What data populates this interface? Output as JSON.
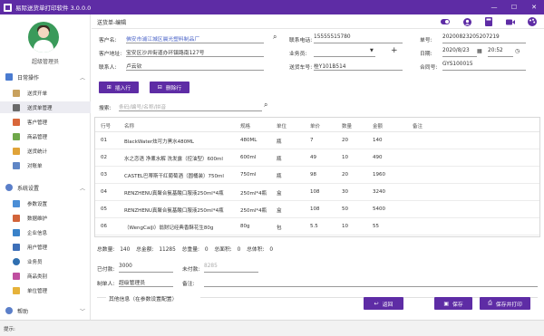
{
  "window": {
    "title": "易际送货单打印软件 3.0.0.0",
    "min": "—",
    "max": "☐",
    "close": "✕"
  },
  "user": {
    "name": "超级管理员"
  },
  "sidebar": {
    "groups": [
      {
        "label": "日常操作",
        "items": [
          "送货开单",
          "送货单管理",
          "客户管理",
          "商品管理",
          "送货统计",
          "对账单"
        ]
      },
      {
        "label": "系统设置",
        "items": [
          "参数设置",
          "数据维护",
          "企业信息",
          "用户管理",
          "业务员",
          "商品类别",
          "单位管理"
        ]
      },
      {
        "label": "帮助"
      }
    ]
  },
  "breadcrumb": "送货单-编辑",
  "form": {
    "customer_name_label": "客户名:",
    "customer_name": "佛安市浦江城区晨光塑料制品厂",
    "contact_phone_label": "联系电话:",
    "contact_phone": "15555515780",
    "order_no_label": "单号:",
    "order_no": "20200823205207219",
    "address_label": "客户地址:",
    "address": "宝安区沙井街道办环镇路南127号",
    "salesman_label": "业务员:",
    "salesman": "",
    "date_label": "日期:",
    "date": "2020/8/23",
    "time": "20:52",
    "contact_label": "联系人:",
    "contact": "卢云钦",
    "carrier_label": "送货车号:",
    "carrier": "桂Y101B514",
    "contract_label": "合同号:",
    "contract": "GYS100015"
  },
  "actions": {
    "insert": "插入行",
    "delete": "删除行"
  },
  "search": {
    "label": "搜索:",
    "placeholder": "条码/编号/名称/拼音"
  },
  "table": {
    "headers": [
      "行号",
      "名称",
      "规格",
      "单位",
      "单价",
      "数量",
      "金额",
      "备注"
    ],
    "rows": [
      [
        "01",
        "BlackWater炫可力黑水480ML",
        "480ML",
        "瓶",
        "7",
        "20",
        "140",
        ""
      ],
      [
        "02",
        "水之恋语 净薰水解 洗发露（控油型）600ml",
        "600ml",
        "瓶",
        "49",
        "10",
        "490",
        ""
      ],
      [
        "03",
        "CASTEL巴蒂斯干红葡萄酒（圆桶装）750ml",
        "750ml",
        "瓶",
        "98",
        "20",
        "1960",
        ""
      ],
      [
        "04",
        "RENZHENU真聚合氨基酸口服液250ml*4瓶",
        "250ml*4瓶",
        "盒",
        "108",
        "30",
        "3240",
        ""
      ],
      [
        "05",
        "RENZHENU真聚合氨基酸口服液250ml*4瓶",
        "250ml*4瓶",
        "盒",
        "108",
        "50",
        "5400",
        ""
      ],
      [
        "06",
        "（WengCaiJi）翁财记经典香酥花生80g",
        "80g",
        "包",
        "5.5",
        "10",
        "55",
        ""
      ]
    ]
  },
  "summary": {
    "total_qty_label": "总数量:",
    "total_qty": "140",
    "total_amount_label": "总金额:",
    "total_amount": "11285",
    "total_weight_label": "总重量:",
    "total_weight": "0",
    "total_area_label": "总面积:",
    "total_area": "0",
    "total_volume_label": "总体积:",
    "total_volume": "0",
    "paid_label": "已付款:",
    "paid": "3000",
    "unpaid_label": "未付款:",
    "unpaid": "8285",
    "creator_label": "制单人:",
    "creator": "超级管理员",
    "remark_label": "备注:",
    "remark": "",
    "other_info": "其他信息（在参数设置配置）"
  },
  "footer": {
    "back": "返回",
    "save": "保存",
    "save_print": "保存并打印"
  },
  "status": {
    "hint": "提示:"
  },
  "colors": {
    "accent": "#5e2ca5",
    "link": "#4a63c7"
  }
}
